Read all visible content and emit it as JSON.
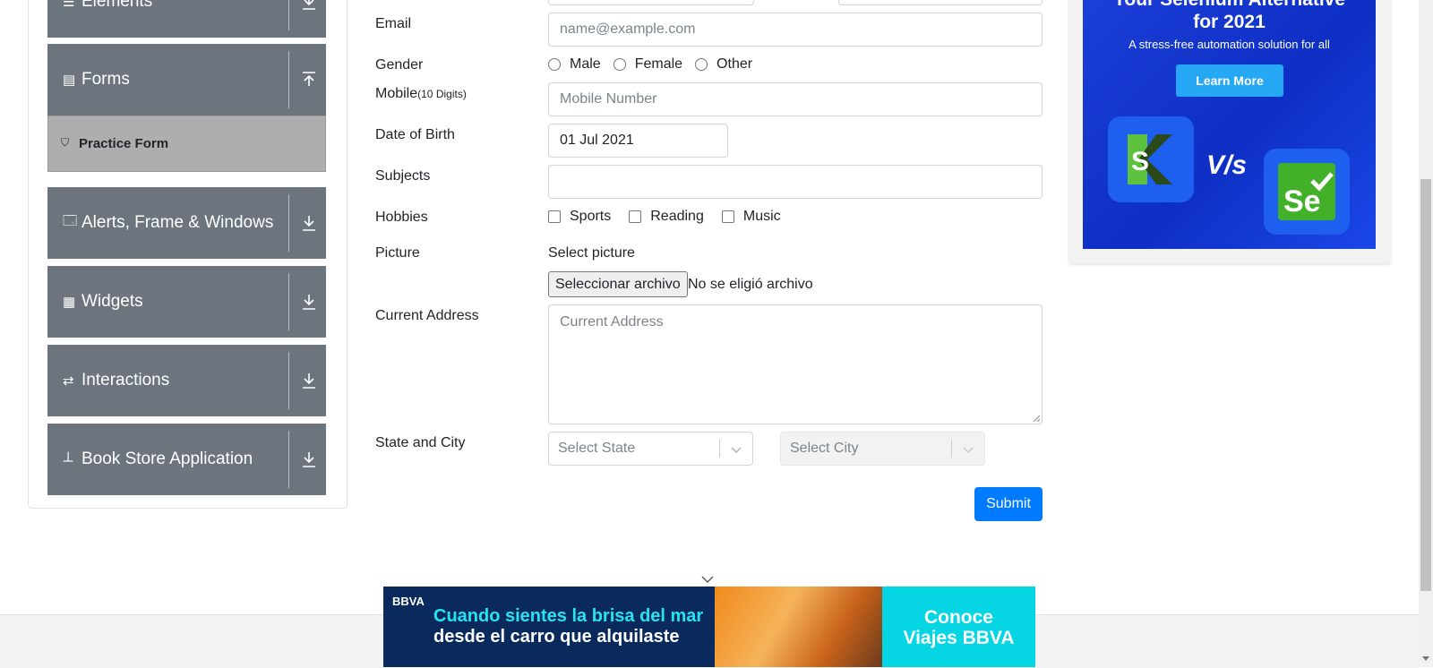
{
  "sidebar": {
    "groups": [
      {
        "label": "Elements",
        "icon": "list-icon"
      },
      {
        "label": "Forms",
        "icon": "document-icon"
      },
      {
        "label": "Alerts, Frame & Windows",
        "icon": "window-icon"
      },
      {
        "label": "Widgets",
        "icon": "widgets-icon"
      },
      {
        "label": "Interactions",
        "icon": "interactions-icon"
      },
      {
        "label": "Book Store Application",
        "icon": "books-icon"
      }
    ],
    "active_item": "Practice Form"
  },
  "form": {
    "email_label": "Email",
    "email_placeholder": "name@example.com",
    "gender_label": "Gender",
    "gender_options": [
      "Male",
      "Female",
      "Other"
    ],
    "mobile_label": "Mobile",
    "mobile_hint": "(10 Digits)",
    "mobile_placeholder": "Mobile Number",
    "dob_label": "Date of Birth",
    "dob_value": "01 Jul 2021",
    "subjects_label": "Subjects",
    "hobbies_label": "Hobbies",
    "hobbies": [
      "Sports",
      "Reading",
      "Music"
    ],
    "picture_label": "Picture",
    "select_picture": "Select picture",
    "file_button": "Seleccionar archivo",
    "file_status": "No se eligió archivo",
    "address_label": "Current Address",
    "address_placeholder": "Current Address",
    "state_city_label": "State and City",
    "state_placeholder": "Select State",
    "city_placeholder": "Select City",
    "submit": "Submit"
  },
  "right_ad": {
    "title_line1": "Your Selenium Alternative",
    "title_line2": "for 2021",
    "subtitle": "A stress-free automation solution for all",
    "button": "Learn More",
    "vs_text": "V/s"
  },
  "bottom_ad": {
    "logo": "BBVA",
    "line1": "Cuando sientes la brisa del mar",
    "line2": "desde el carro que alquilaste",
    "cta_line1": "Conoce",
    "cta_line2": "Viajes BBVA"
  },
  "colors": {
    "sidebar_group": "#6c757d",
    "active_item": "#aeaeae",
    "primary": "#007bff",
    "ad_blue": "#1b3fd8",
    "bbva_navy": "#0a2a5e",
    "bbva_cyan": "#06d6e3"
  }
}
